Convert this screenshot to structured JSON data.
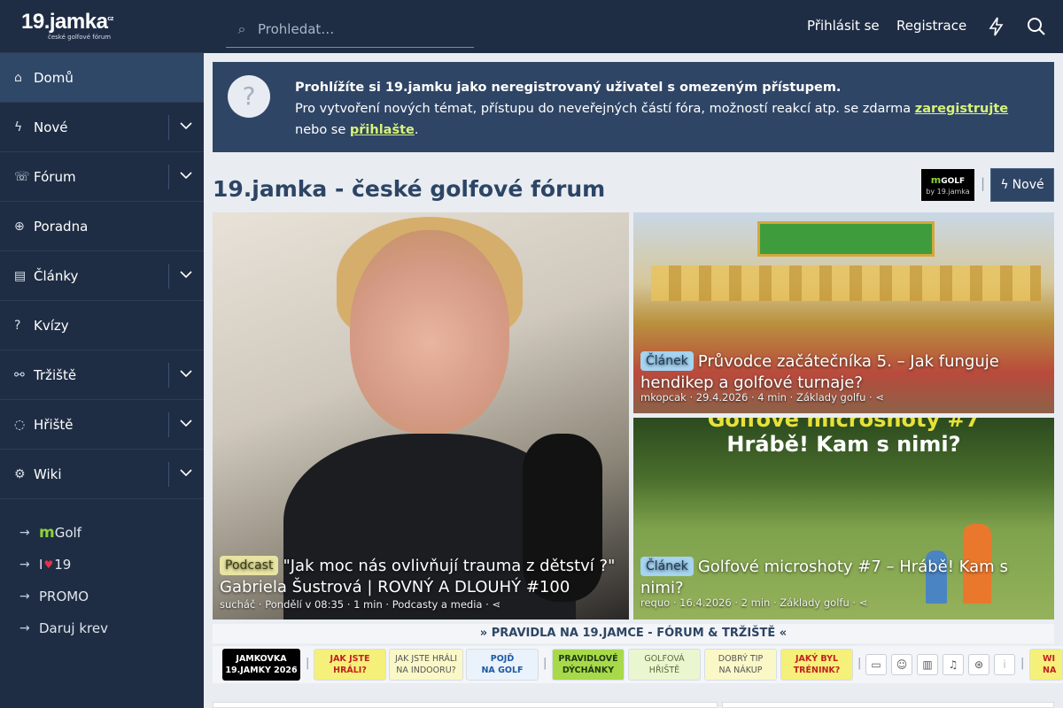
{
  "brand": {
    "logo_text": "19.jamka",
    "logo_tld": "cz",
    "logo_sub": "české golfové fórum"
  },
  "header": {
    "search_placeholder": "Prohledat…",
    "login": "Přihlásit se",
    "register": "Registrace"
  },
  "sidebar": {
    "items": [
      {
        "label": "Domů",
        "icon": "home-icon"
      },
      {
        "label": "Nové",
        "icon": "bolt-icon"
      },
      {
        "label": "Fórum",
        "icon": "chat-icon"
      },
      {
        "label": "Poradna",
        "icon": "lifebuoy-icon"
      },
      {
        "label": "Články",
        "icon": "document-icon"
      },
      {
        "label": "Kvízy",
        "icon": "question-icon"
      },
      {
        "label": "Tržiště",
        "icon": "handshake-icon"
      },
      {
        "label": "Hřiště",
        "icon": "golf-ball-icon"
      },
      {
        "label": "Wiki",
        "icon": "gear-icon"
      }
    ],
    "sub_items": {
      "mgolf_m": "m",
      "mgolf_rest": "Golf",
      "i19_i": "I",
      "i19_heart": "♥",
      "i19_num": "19",
      "promo": "PROMO",
      "daruj": "Daruj krev"
    }
  },
  "notice": {
    "heading": "Prohlížíte si 19.jamku jako neregistrovaný uživatel s omezeným přístupem.",
    "text_before": "Pro vytvoření nových témat, přístupu do neveřejných částí fóra, možností reakcí atp. se zdarma ",
    "register_link": "zaregistrujte",
    "text_middle": " nebo se ",
    "login_link": "přihlašte",
    "text_after": "."
  },
  "page": {
    "title": "19.jamka - české golfové fórum",
    "badge_m": "m",
    "badge_golf": "GOLF",
    "badge_by": "by 19.jamka",
    "separator": "|",
    "new_button": "Nové"
  },
  "cards": {
    "main": {
      "tag": "Podcast",
      "title": "\"Jak moc nás ovlivňují trauma z dětství ?\" Gabriela Šustrová | ROVNÝ A DLOUHÝ #100",
      "author": "sucháč",
      "date": "Pondělí v 08:35",
      "read": "1 min",
      "category": "Podcasty a media"
    },
    "a": {
      "tag": "Článek",
      "title": "Průvodce začátečníka 5. – Jak funguje hendikep a golfové turnaje?",
      "author": "mkopcak",
      "date": "29.4.2026",
      "read": "4 min",
      "category": "Základy golfu"
    },
    "b": {
      "tag": "Článek",
      "title": "Golfové microshoty #7 – Hrábě! Kam s nimi?",
      "image_line1": "Golfové microshoty #7",
      "image_line2": "Hrábě! Kam s nimi?",
      "author": "requo",
      "date": "16.4.2026",
      "read": "2 min",
      "category": "Základy golfu"
    }
  },
  "rules": {
    "text": "» PRAVIDLA NA 19.JAMCE - FÓRUM & TRŽIŠTĚ «"
  },
  "quick_buttons": [
    {
      "l1": "JAMKOVKA",
      "l2": "19.JAMKY 2026"
    },
    {
      "l1": "JAK JSTE",
      "l2": "HRÁLI?"
    },
    {
      "l1": "JAK JSTE HRÁLI",
      "l2": "NA INDOORU?"
    },
    {
      "l1": "POJĎ",
      "l2": "NA GOLF"
    },
    {
      "l1": "PRAVIDLOVÉ",
      "l2": "DÝCHÁNKY"
    },
    {
      "l1": "GOLFOVÁ",
      "l2": "HŘIŠTĚ"
    },
    {
      "l1": "DOBRÝ TIP",
      "l2": "NA NÁKUP"
    },
    {
      "l1": "JAKÝ BYL",
      "l2": "TRÉNINK?"
    },
    {
      "l1": "WI",
      "l2": "NA"
    }
  ],
  "colors": {
    "sidebar": "#1f2d44",
    "accent_green": "#8dd13c",
    "notice_bg": "#2f4565"
  }
}
